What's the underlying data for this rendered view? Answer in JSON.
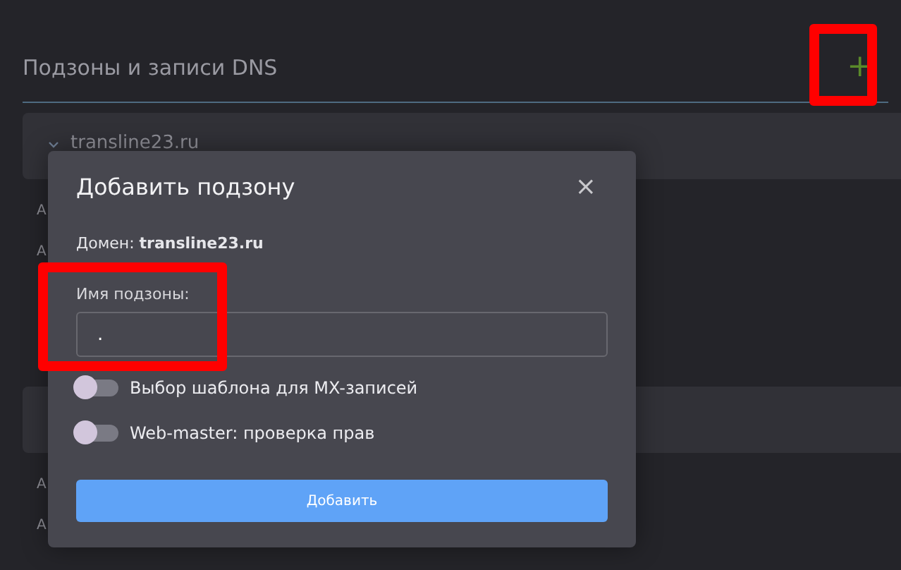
{
  "section": {
    "title": "Подзоны и записи DNS",
    "add_icon": "+"
  },
  "domains": [
    {
      "name": "transline23.ru",
      "expanded": true,
      "rows": [
        "A",
        "A"
      ]
    },
    {
      "rows": [
        "A",
        "A"
      ]
    }
  ],
  "dialog": {
    "title": "Добавить подзону",
    "close": "×",
    "domain_label": "Домен: **transline23.ru**",
    "field_label": "Имя подзоны:",
    "field_value": ".",
    "toggles": [
      {
        "label": "Выбор шаблона для MX-записей",
        "on": false
      },
      {
        "label": "Web-master: проверка прав",
        "on": false
      }
    ],
    "submit": "Добавить"
  }
}
